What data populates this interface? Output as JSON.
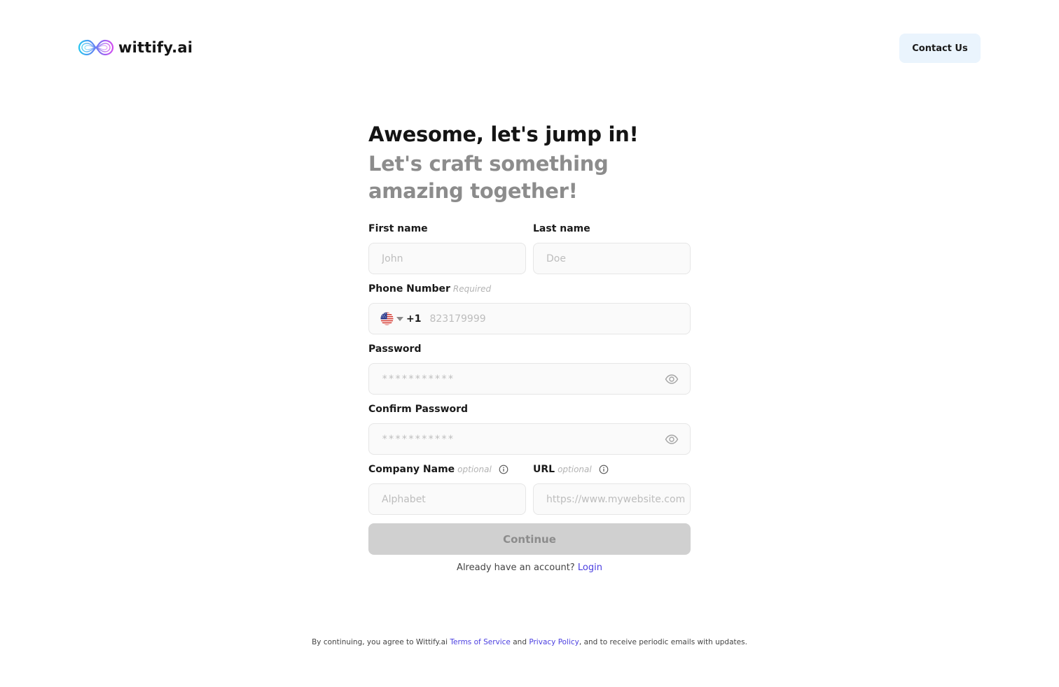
{
  "header": {
    "logo_text": "wittify.ai",
    "contact_label": "Contact Us"
  },
  "hero": {
    "title": "Awesome, let's jump in!",
    "subtitle": "Let's craft something amazing together!"
  },
  "form": {
    "first_name": {
      "label": "First name",
      "placeholder": "John",
      "value": ""
    },
    "last_name": {
      "label": "Last name",
      "placeholder": "Doe",
      "value": ""
    },
    "phone": {
      "label": "Phone Number",
      "hint": "Required",
      "country_code": "+1",
      "placeholder": "823179999",
      "value": ""
    },
    "password": {
      "label": "Password",
      "placeholder": "***********",
      "value": ""
    },
    "confirm_password": {
      "label": "Confirm Password",
      "placeholder": "***********",
      "value": ""
    },
    "company": {
      "label": "Company Name",
      "hint": "optional",
      "placeholder": "Alphabet",
      "value": ""
    },
    "url": {
      "label": "URL",
      "hint": "optional",
      "placeholder": "https://www.mywebsite.com",
      "value": ""
    },
    "continue_label": "Continue",
    "login_prompt": "Already have an account?",
    "login_link": "Login"
  },
  "footer": {
    "prefix": "By continuing, you agree to Wittify.ai",
    "terms": "Terms of Service",
    "and": "and",
    "privacy": "Privacy Policy",
    "suffix": ", and to receive periodic emails with updates."
  },
  "icons": {
    "logo": "infinity-logo-icon",
    "flag": "us-flag-icon",
    "caret": "chevron-down-icon",
    "eye": "eye-icon",
    "info": "info-icon"
  },
  "colors": {
    "accent_link": "#4a3ee0",
    "contact_bg": "#eaf4fd",
    "disabled_button": "#d0d0d0",
    "subtitle_gray": "#8c8c8c"
  }
}
